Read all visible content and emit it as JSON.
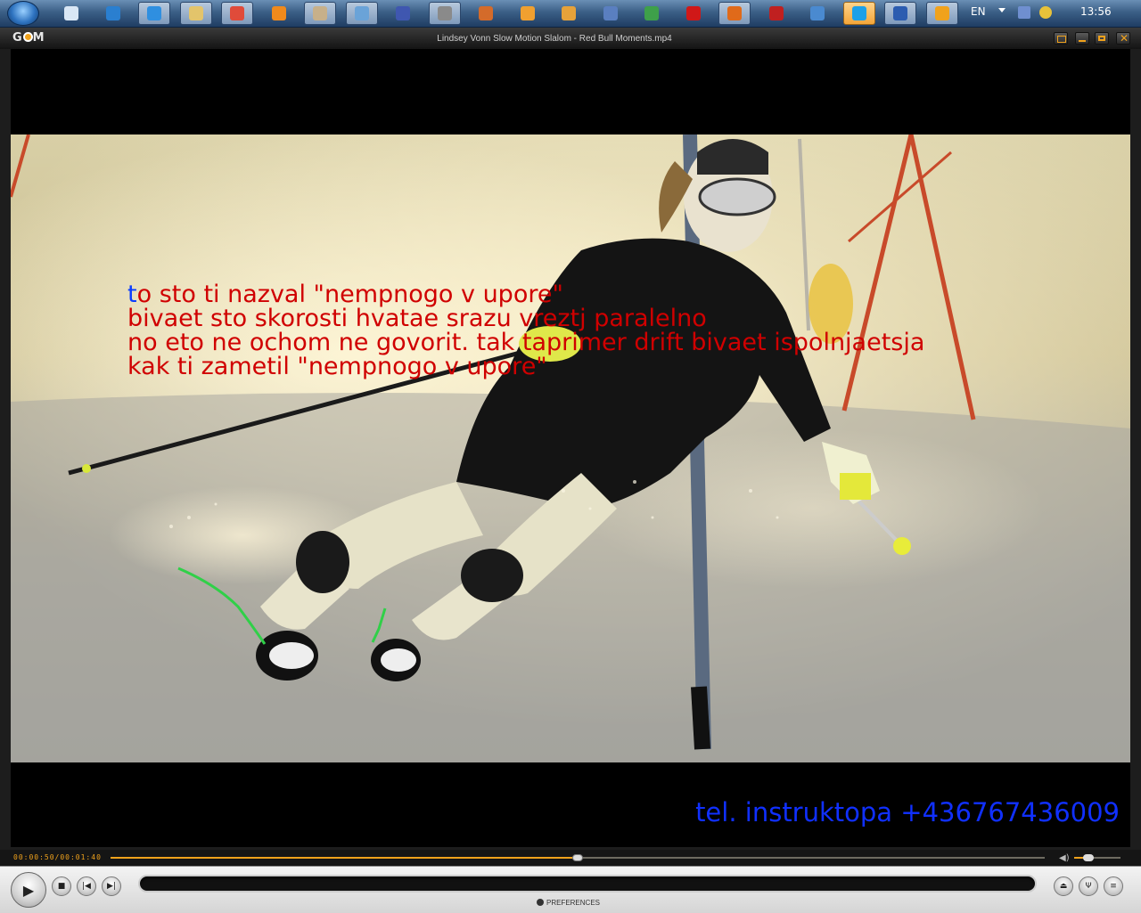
{
  "taskbar": {
    "apps": [
      {
        "name": "notepad",
        "color": "#d9e7f5"
      },
      {
        "name": "windows-live",
        "color": "#2a7fd0"
      },
      {
        "name": "internet-explorer",
        "color": "#2f8fe0",
        "active": true
      },
      {
        "name": "explorer",
        "color": "#e3c46b",
        "active": true
      },
      {
        "name": "chrome",
        "color": "#e04b3a",
        "active": true
      },
      {
        "name": "vlc",
        "color": "#f08a1c"
      },
      {
        "name": "app-7",
        "color": "#c7b08a",
        "active": true
      },
      {
        "name": "app-8",
        "color": "#6aa3d8",
        "active": true
      },
      {
        "name": "app-9",
        "color": "#3f57b0"
      },
      {
        "name": "app-10",
        "color": "#8a8a8a",
        "active": true
      },
      {
        "name": "app-11",
        "color": "#d46b2a"
      },
      {
        "name": "media-player",
        "color": "#f0a030"
      },
      {
        "name": "app-13",
        "color": "#e6a23a"
      },
      {
        "name": "app-14",
        "color": "#5a7fc0"
      },
      {
        "name": "app-15",
        "color": "#3ea04a"
      },
      {
        "name": "opera",
        "color": "#d01818"
      },
      {
        "name": "firefox",
        "color": "#e06a1a",
        "active": true
      },
      {
        "name": "filezilla",
        "color": "#c02020"
      },
      {
        "name": "app-19",
        "color": "#4a8ad0"
      },
      {
        "name": "skype",
        "color": "#1da0e8",
        "highlight": true
      },
      {
        "name": "word",
        "color": "#2b5cb0",
        "active": true
      },
      {
        "name": "gom-player",
        "color": "#f0a21c",
        "active": true
      }
    ],
    "language": "EN",
    "clock": "13:56"
  },
  "player": {
    "title": "Lindsey Vonn Slow Motion Slalom - Red Bull Moments.mp4",
    "logo": "GOM",
    "subtitles": {
      "line1_first": "t",
      "line1_rest": "o sto ti nazval \"nempnogo v upore\"",
      "line2": "bivaet sto skorosti hvatae srazu vreztj paralelno",
      "line3": "no eto ne ochom ne govorit. tak taprimer drift bivaet ispolnjaetsja",
      "line4": "kak ti zametil \"nempnogo v upore\""
    },
    "caption": "tel. instruktopa +436767436009",
    "time_display": "00:00:50/00:01:40",
    "seek_fraction": 0.5,
    "volume_fraction": 0.3,
    "preferences_label": "PREFERENCES"
  }
}
